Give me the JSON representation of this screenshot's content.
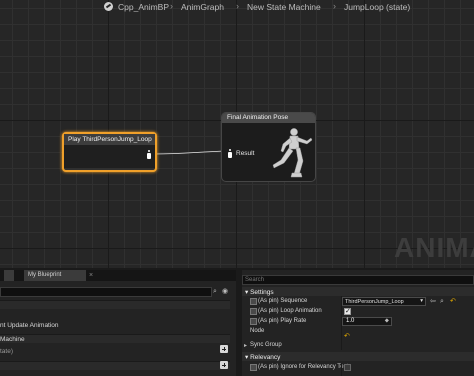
{
  "breadcrumb": {
    "items": [
      "Cpp_AnimBP",
      "AnimGraph",
      "New State Machine",
      "JumpLoop (state)"
    ],
    "separator": "›"
  },
  "graph": {
    "play_node": {
      "title": "Play ThirdPersonJump_Loop"
    },
    "final_node": {
      "title": "Final Animation Pose",
      "pin_label": "Result"
    },
    "watermark": "ANIMA"
  },
  "left_panel": {
    "tab_label": "My Blueprint",
    "tab_close": "×",
    "search_placeholder": "",
    "lines": [
      "nt Update Animation",
      "Machine",
      "tate)"
    ]
  },
  "details": {
    "search_placeholder": "Search",
    "settings_header": "Settings",
    "relevancy_header": "Relevancy",
    "rows": [
      {
        "label": "(As pin) Sequence",
        "value": "ThirdPersonJump_Loop"
      },
      {
        "label": "(As pin) Loop Animation",
        "checked": true
      },
      {
        "label": "(As pin) Play Rate",
        "value": "1.0"
      },
      {
        "label": "Node"
      },
      {
        "label": "Sync Group"
      },
      {
        "label": "(As pin) Ignore for Relevancy Test",
        "checked": false
      }
    ]
  },
  "colors": {
    "selection_outline": "#f0a02a",
    "graph_background": "#262626",
    "reset_arrow": "#e0a800"
  }
}
